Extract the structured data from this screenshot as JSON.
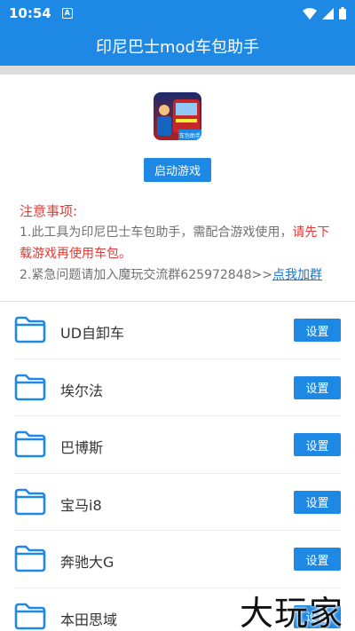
{
  "status_bar": {
    "time": "10:54",
    "notification_icon": "A"
  },
  "app_bar": {
    "title": "印尼巴士mod车包助手"
  },
  "app_icon": {
    "caption": "车包助手"
  },
  "start_button": "启动游戏",
  "notice": {
    "title": "注意事项:",
    "line1_normal": "1.此工具为印尼巴士车包助手，需配合游戏使用，",
    "line1_red": "请先下载游戏再使用车包。",
    "line2_normal": "2.紧急问题请加入魔玩交流群625972848>>",
    "line2_link": "点我加群"
  },
  "items": [
    {
      "name": "UD自卸车",
      "button": "设置"
    },
    {
      "name": "埃尔法",
      "button": "设置"
    },
    {
      "name": "巴博斯",
      "button": "设置"
    },
    {
      "name": "宝马i8",
      "button": "设置"
    },
    {
      "name": "奔驰大G",
      "button": "设置"
    },
    {
      "name": "本田思域",
      "button": "设置"
    }
  ],
  "watermark": "大玩家",
  "colors": {
    "primary": "#1e88e5",
    "warning": "#e53935",
    "link": "#1976d2"
  }
}
